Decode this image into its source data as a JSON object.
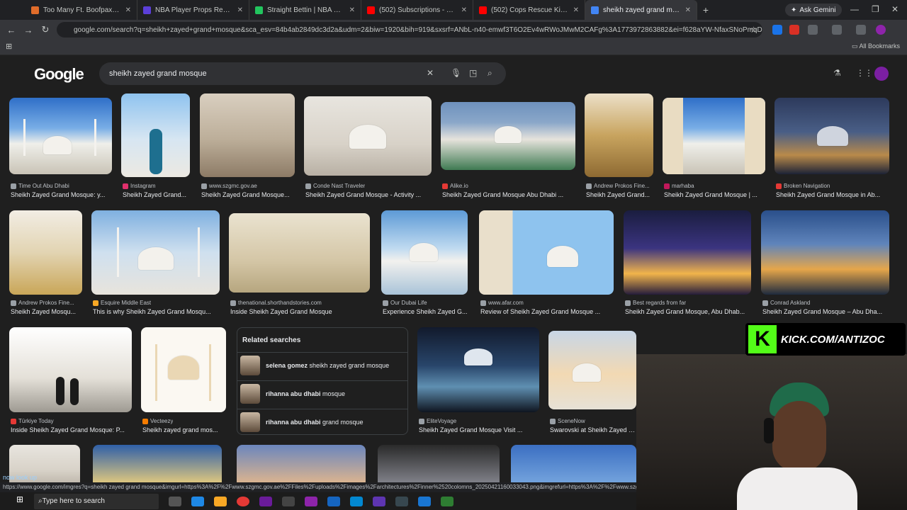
{
  "browser": {
    "tabs": [
      {
        "title": "Too Many Ft. Boofpaxkmoo",
        "fav": "#e06c2a"
      },
      {
        "title": "NBA Player Props Research | Pr",
        "fav": "#5b3fd9"
      },
      {
        "title": "Straight Bettin | NBA Player Pr",
        "fav": "#22c55e"
      },
      {
        "title": "(502) Subscriptions - YouTube",
        "fav": "#ff0000"
      },
      {
        "title": "(502) Cops Rescue Killer's Lates",
        "fav": "#ff0000"
      },
      {
        "title": "sheikh zayed grand mosque - G",
        "fav": "#4285f4"
      }
    ],
    "new_tab": "+",
    "ask_gemini": "Ask Gemini",
    "url": "google.com/search?q=sheikh+zayed+grand+mosque&sca_esv=84b4ab2849dc3d2a&udm=2&biw=1920&bih=919&sxsrf=ANbL-n40-emwf3T6O2Ev4wRWoJMwM2CAFg%3A1773972863882&ei=f628aYW-NfaxSNoPmqDV8Q08...",
    "all_bookmarks": "All Bookmarks"
  },
  "google": {
    "logo": "Google",
    "query": "sheikh zayed grand mosque"
  },
  "results": [
    {
      "source": "Time Out Abu Dhabi",
      "caption": "Sheikh Zayed Grand Mosque: y..."
    },
    {
      "source": "Instagram",
      "caption": "Sheikh Zayed Grand..."
    },
    {
      "source": "www.szgmc.gov.ae",
      "caption": "Sheikh Zayed Grand Mosque..."
    },
    {
      "source": "Conde Nast Traveler",
      "caption": "Sheikh Zayed Grand Mosque - Activity ..."
    },
    {
      "source": "Alike.io",
      "caption": "Sheikh Zayed Grand Mosque Abu Dhabi ..."
    },
    {
      "source": "Andrew Prokos Fine...",
      "caption": "Sheikh Zayed Grand..."
    },
    {
      "source": "marhaba",
      "caption": "Sheikh Zayed Grand Mosque | ..."
    },
    {
      "source": "Broken Navigation",
      "caption": "Sheikh Zayed Grand Mosque in Ab..."
    },
    {
      "source": "Andrew Prokos Fine...",
      "caption": "Sheikh Zayed Mosqu..."
    },
    {
      "source": "Esquire Middle East",
      "caption": "This is why Sheikh Zayed Grand Mosqu..."
    },
    {
      "source": "thenational.shorthandstories.com",
      "caption": "Inside Sheikh Zayed Grand Mosque"
    },
    {
      "source": "Our Dubai Life",
      "caption": "Experience Sheikh Zayed G..."
    },
    {
      "source": "www.afar.com",
      "caption": "Review of Sheikh Zayed Grand Mosque ..."
    },
    {
      "source": "Best regards from far",
      "caption": "Sheikh Zayed Grand Mosque, Abu Dhab..."
    },
    {
      "source": "Conrad Askland",
      "caption": "Sheikh Zayed Grand Mosque – Abu Dha..."
    },
    {
      "source": "Türkiye Today",
      "caption": "Inside Sheikh Zayed Grand Mosque: P..."
    },
    {
      "source": "Vecteezy",
      "caption": "Sheikh zayed grand mos..."
    },
    {
      "source": "EliteVoyage",
      "caption": "Sheikh Zayed Grand Mosque Visit ..."
    },
    {
      "source": "SceneNow",
      "caption": "Swarovski at Sheikh Zayed G..."
    }
  ],
  "related": {
    "title": "Related searches",
    "items": [
      {
        "bold": "selena gomez",
        "rest": " sheikh zayed grand mosque"
      },
      {
        "bold": "rihanna abu dhabi",
        "rest": " mosque"
      },
      {
        "bold": "rihanna abu dhabi",
        "rest": " grand mosque"
      }
    ]
  },
  "overlay": {
    "kick_letter": "K",
    "kick_text": "KICK.COM/ANTIZOC"
  },
  "status_url": "https://www.google.com/imgres?q=sheikh zayed grand mosque&imgurl=https%3A%2F%2Fwww.szgmc.gov.ae%2FFiles%2Fuploads%2Fimages%2Farchitectures%2Finner%2520colomns_20250421160033043.png&imgrefurl=https%3A%2F%2Fwww.szgmc",
  "chat_line": "now look up",
  "taskbar": {
    "search_placeholder": "Type here to search"
  }
}
